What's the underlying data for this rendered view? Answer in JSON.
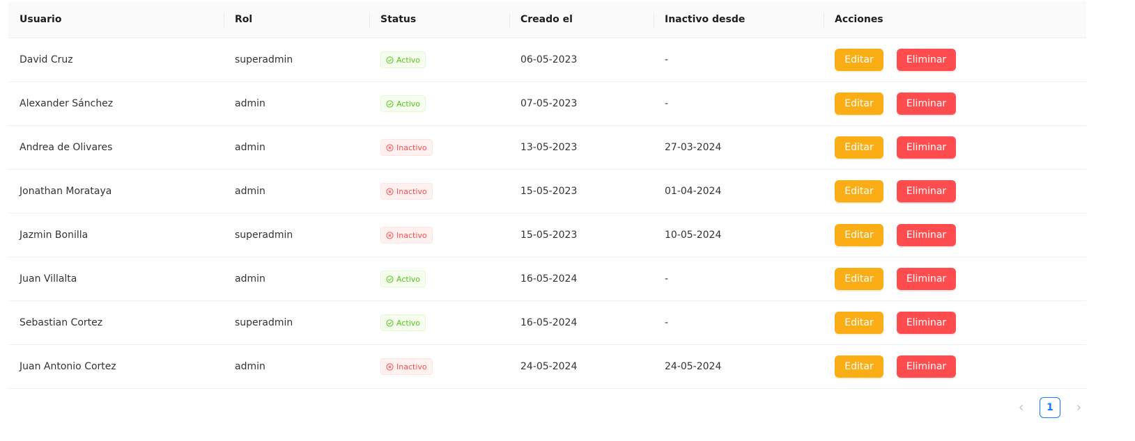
{
  "table": {
    "headers": {
      "user": "Usuario",
      "role": "Rol",
      "status": "Status",
      "created": "Creado el",
      "inactive_since": "Inactivo desde",
      "actions": "Acciones"
    },
    "edit_label": "Editar",
    "delete_label": "Eliminar",
    "rows": [
      {
        "user": "David Cruz",
        "role": "superadmin",
        "status": "Activo",
        "created": "06-05-2023",
        "inactive_since": "-"
      },
      {
        "user": "Alexander Sánchez",
        "role": "admin",
        "status": "Activo",
        "created": "07-05-2023",
        "inactive_since": "-"
      },
      {
        "user": "Andrea de Olivares",
        "role": "admin",
        "status": "Inactivo",
        "created": "13-05-2023",
        "inactive_since": "27-03-2024"
      },
      {
        "user": "Jonathan Morataya",
        "role": "admin",
        "status": "Inactivo",
        "created": "15-05-2023",
        "inactive_since": "01-04-2024"
      },
      {
        "user": "Jazmin Bonilla",
        "role": "superadmin",
        "status": "Inactivo",
        "created": "15-05-2023",
        "inactive_since": "10-05-2024"
      },
      {
        "user": "Juan Villalta",
        "role": "admin",
        "status": "Activo",
        "created": "16-05-2024",
        "inactive_since": "-"
      },
      {
        "user": "Sebastian Cortez",
        "role": "superadmin",
        "status": "Activo",
        "created": "16-05-2024",
        "inactive_since": "-"
      },
      {
        "user": "Juan Antonio Cortez",
        "role": "admin",
        "status": "Inactivo",
        "created": "24-05-2024",
        "inactive_since": "24-05-2024"
      }
    ]
  },
  "pagination": {
    "current_page": "1",
    "prev_icon": "chevron-left-icon",
    "next_icon": "chevron-right-icon"
  },
  "colors": {
    "edit_button": "#faad14",
    "delete_button": "#ff4d4f",
    "status_active": "#52c41a",
    "status_inactive": "#ff4d4f",
    "pagination_active": "#1677ff"
  }
}
